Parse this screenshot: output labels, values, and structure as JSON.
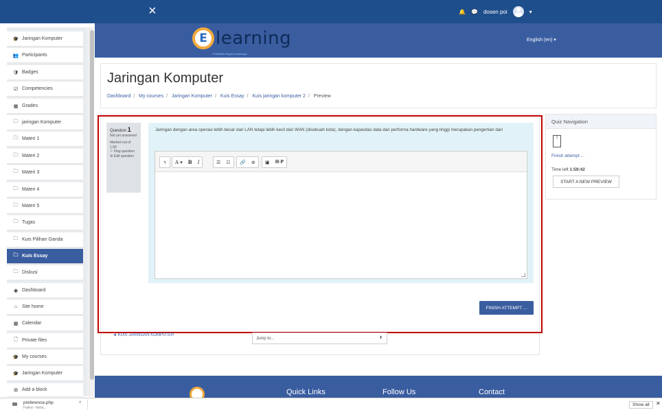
{
  "topbar": {
    "close_glyph": "×",
    "user_name": "dosen poi"
  },
  "banner": {
    "logo_letter": "E",
    "logo_text": "learning",
    "logo_subtitle": "Politeknik Negeri Indramayu",
    "language": "English (en) ▾"
  },
  "sidebar": {
    "items": [
      {
        "icon": "graduation-cap-icon",
        "glyph": "🎓",
        "label": "Jaringan Komputer"
      },
      {
        "icon": "users-icon",
        "glyph": "👥",
        "label": "Participants"
      },
      {
        "icon": "badge-icon",
        "glyph": "🛡",
        "label": "Badges"
      },
      {
        "icon": "checkbox-icon",
        "glyph": "☑",
        "label": "Competencies"
      },
      {
        "icon": "table-icon",
        "glyph": "▦",
        "label": "Grades"
      },
      {
        "icon": "folder-icon",
        "glyph": "🗀",
        "label": "jaringan Komputer"
      },
      {
        "icon": "folder-icon",
        "glyph": "🗀",
        "label": "Materi 1"
      },
      {
        "icon": "folder-icon",
        "glyph": "🗀",
        "label": "Materi 2"
      },
      {
        "icon": "folder-icon",
        "glyph": "🗀",
        "label": "Materi 3"
      },
      {
        "icon": "folder-icon",
        "glyph": "🗀",
        "label": "Materi 4"
      },
      {
        "icon": "folder-icon",
        "glyph": "🗀",
        "label": "Materi 5"
      },
      {
        "icon": "folder-icon",
        "glyph": "🗀",
        "label": "Tugas"
      },
      {
        "icon": "folder-icon",
        "glyph": "🗀",
        "label": "Kuis Pilihan Ganda"
      },
      {
        "icon": "folder-icon",
        "glyph": "🗀",
        "label": "Kuis Essay"
      },
      {
        "icon": "folder-icon",
        "glyph": "🗀",
        "label": "Diskusi"
      },
      {
        "icon": "dashboard-icon",
        "glyph": "◉",
        "label": "Dashboard"
      },
      {
        "icon": "home-icon",
        "glyph": "⌂",
        "label": "Site home"
      },
      {
        "icon": "calendar-icon",
        "glyph": "▦",
        "label": "Calendar"
      },
      {
        "icon": "file-icon",
        "glyph": "🗋",
        "label": "Private files"
      },
      {
        "icon": "graduation-cap-icon",
        "glyph": "🎓",
        "label": "My courses"
      },
      {
        "icon": "graduation-cap-icon",
        "glyph": "🎓",
        "label": "Jaringan Komputer"
      },
      {
        "icon": "plus-square-icon",
        "glyph": "⊞",
        "label": "Add a block"
      }
    ]
  },
  "page_header": {
    "title": "Jaringan Komputer",
    "breadcrumbs": [
      "Dashboard",
      "My courses",
      "Jaringan Komputer",
      "Kuis Essay",
      "Kuis jaringan komputer 2",
      "Preview"
    ]
  },
  "question": {
    "label": "Question",
    "number": "1",
    "status": "Not yet answered",
    "marked": "Marked out of 1.00",
    "flag": "Flag question",
    "edit": "Edit question",
    "text": "Jaringan dengan area operasi lebih besar dari LAN tetapi lebih kecil dari WAN (disebuah kota), dengan kapasitas data dan performa hardware yang tinggi merupakan pengertian dari"
  },
  "editor_toolbar": {
    "show_more": "⤵",
    "font": "A ▾",
    "bold": "B",
    "italic": "I",
    "ul": "☰",
    "ol": "☷",
    "link": "🔗",
    "unlink": "⊘",
    "image": "▣",
    "h5p": "H·P"
  },
  "finish_button": "FINISH ATTEMPT ...",
  "nav": {
    "prev_link": "◄ KUIS JARINGAN KOMPUTER",
    "jump_to": "Jump to...",
    "jump_arrow": "⬍"
  },
  "quiz_nav": {
    "title": "Quiz Navigation",
    "question_box": "1",
    "finish_link": "Finish attempt ...",
    "time_label": "Time left",
    "time_value": "1:59:42",
    "start_preview": "START A NEW PREVIEW"
  },
  "footer": {
    "quick_links": "Quick Links",
    "follow_us": "Follow Us",
    "contact": "Contact"
  },
  "download_bar": {
    "file_name": "preference.php",
    "file_sub": "Failed - Netw...",
    "chevron": "^",
    "show_all": "Show all",
    "close": "✕"
  }
}
